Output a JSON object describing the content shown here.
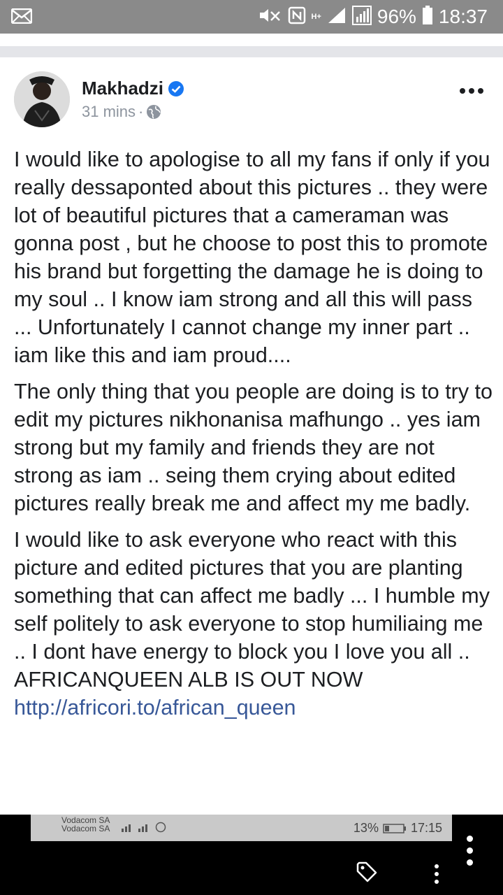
{
  "status_bar": {
    "battery_percent": "96%",
    "time": "18:37",
    "network_type": "H+"
  },
  "post": {
    "author": "Makhadzi",
    "timestamp": "31 mins",
    "separator": "·",
    "paragraphs": [
      "I would like to apologise to all my fans if only if you really dessaponted about this pictures .. they were lot of beautiful pictures that a cameraman was gonna post , but he choose to post this to promote his brand but forgetting the damage he is doing to my soul .. I know iam strong and all this will pass ... Unfortunately I cannot change my inner part .. iam like this and iam proud....",
      "The only thing that you people are doing is to try to edit my pictures nikhonanisa mafhungo .. yes iam strong but my family and friends they are not strong as iam .. seing them crying about edited pictures really break me and affect my me badly.",
      "I would like to ask everyone who react with this picture and edited pictures that you are planting something that can affect me badly ... I humble my self politely to ask everyone to stop humiliaing me .. I dont have energy to block you I love you all .. AFRICANQUEEN ALB IS OUT NOW"
    ],
    "link": "http://africori.to/african_queen"
  },
  "embedded_status": {
    "carrier_1": "Vodacom SA",
    "carrier_2": "Vodacom SA",
    "battery_percent": "13%",
    "time": "17:15"
  },
  "colors": {
    "status_bar_bg": "#8a8a8a",
    "verified_blue": "#1877f2",
    "link": "#385898",
    "text": "#1c1e21",
    "meta_gray": "#8d949e"
  },
  "icons": [
    "mail-icon",
    "mute-icon",
    "nfc-icon",
    "signal-icon",
    "battery-icon",
    "verified-icon",
    "globe-icon",
    "more-icon",
    "tag-icon",
    "kebab-icon"
  ]
}
